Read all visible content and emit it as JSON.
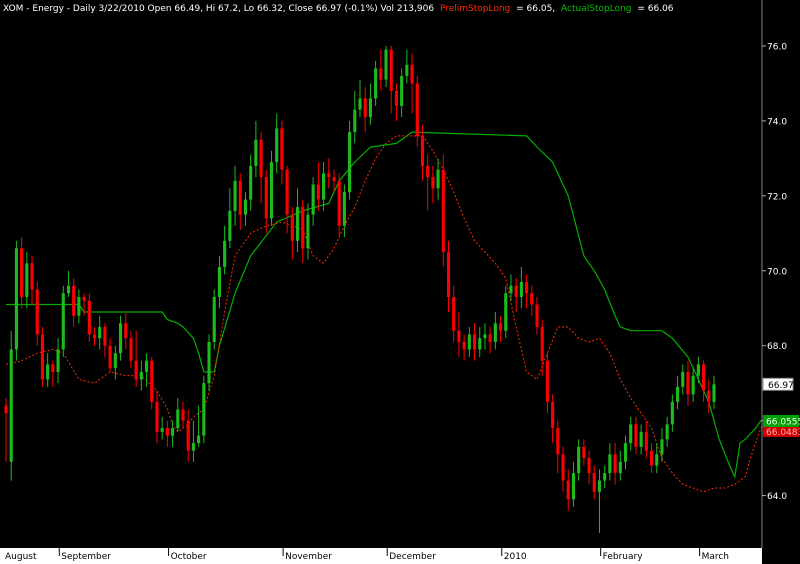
{
  "header": {
    "title": "XOM - Energy - Daily 3/22/2010 Open 66.49, Hi 67.2, Lo 66.32, Close 66.97 (-0.1%) Vol 213,906",
    "prelim_label": "PrelimStopLong",
    "prelim_value": "= 66.05,",
    "actual_label": "ActualStopLong",
    "actual_value": "= 66.06"
  },
  "chart_data": {
    "type": "candlestick",
    "symbol": "XOM",
    "ylim": [
      62.6,
      76.8
    ],
    "y_ticks": [
      "64.0",
      "66.0",
      "68.0",
      "70.0",
      "72.0",
      "74.0",
      "76.0"
    ],
    "x_months": [
      "August",
      "September",
      "October",
      "November",
      "December",
      "2010",
      "February",
      "March"
    ],
    "colors": {
      "up": "#1dbb1d",
      "down": "#ff0000",
      "actual_stop": "#00b000",
      "prelim_stop": "#ff2a00",
      "background": "#000000",
      "axis_bg": "#ffffff"
    },
    "last_close_label": "66.97",
    "actual_stop_label": "66.0555",
    "prelim_stop_label": "66.0483",
    "candles": [
      [
        66.4,
        66.2,
        64.9,
        66.6
      ],
      [
        64.9,
        67.9,
        64.4,
        68.4
      ],
      [
        67.9,
        70.6,
        67.6,
        70.8
      ],
      [
        70.6,
        69.3,
        69.0,
        70.9
      ],
      [
        69.3,
        70.2,
        69.0,
        70.5
      ],
      [
        70.2,
        69.5,
        69.1,
        70.4
      ],
      [
        69.5,
        68.3,
        68.0,
        69.7
      ],
      [
        68.3,
        67.1,
        66.9,
        68.5
      ],
      [
        67.1,
        67.5,
        66.9,
        67.8
      ],
      [
        67.5,
        67.3,
        66.9,
        67.6
      ],
      [
        67.3,
        67.9,
        67.0,
        68.2
      ],
      [
        67.9,
        69.4,
        67.7,
        69.6
      ],
      [
        69.4,
        69.6,
        69.3,
        70.0
      ],
      [
        69.6,
        68.8,
        68.5,
        69.8
      ],
      [
        68.8,
        69.3,
        68.6,
        69.5
      ],
      [
        69.3,
        69.2,
        68.8,
        69.4
      ],
      [
        69.2,
        68.3,
        68.1,
        69.4
      ],
      [
        68.3,
        68.2,
        68.0,
        68.5
      ],
      [
        68.2,
        68.5,
        67.9,
        68.8
      ],
      [
        68.5,
        68.0,
        67.7,
        68.6
      ],
      [
        68.0,
        67.4,
        67.3,
        68.2
      ],
      [
        67.4,
        67.8,
        67.1,
        68.0
      ],
      [
        67.8,
        68.6,
        67.6,
        68.8
      ],
      [
        68.6,
        68.2,
        67.9,
        68.9
      ],
      [
        68.2,
        67.6,
        67.4,
        68.4
      ],
      [
        67.6,
        67.1,
        66.9,
        68.4
      ],
      [
        67.1,
        67.3,
        66.8,
        67.6
      ],
      [
        67.3,
        67.6,
        66.9,
        67.8
      ],
      [
        67.6,
        66.5,
        66.3,
        67.7
      ],
      [
        66.5,
        65.7,
        65.4,
        66.8
      ],
      [
        65.7,
        65.8,
        65.5,
        66.1
      ],
      [
        65.8,
        65.6,
        65.3,
        66.0
      ],
      [
        65.6,
        65.8,
        65.3,
        66.0
      ],
      [
        65.8,
        66.3,
        65.7,
        66.6
      ],
      [
        66.3,
        66.0,
        65.8,
        66.5
      ],
      [
        66.0,
        65.2,
        64.9,
        66.3
      ],
      [
        65.2,
        65.4,
        64.9,
        66.0
      ],
      [
        65.4,
        65.6,
        65.3,
        66.4
      ],
      [
        65.6,
        67.0,
        65.4,
        67.2
      ],
      [
        67.0,
        68.1,
        66.8,
        68.3
      ],
      [
        68.1,
        69.3,
        67.9,
        69.5
      ],
      [
        69.3,
        70.1,
        69.0,
        70.4
      ],
      [
        70.1,
        70.8,
        69.9,
        71.2
      ],
      [
        70.8,
        71.6,
        70.6,
        72.2
      ],
      [
        71.6,
        72.4,
        71.2,
        72.8
      ],
      [
        72.4,
        71.5,
        71.1,
        72.6
      ],
      [
        71.5,
        71.9,
        71.2,
        72.1
      ],
      [
        71.9,
        72.8,
        71.6,
        73.1
      ],
      [
        72.8,
        73.5,
        72.5,
        74.0
      ],
      [
        73.5,
        72.5,
        71.8,
        73.7
      ],
      [
        72.5,
        71.4,
        71.0,
        72.7
      ],
      [
        71.4,
        72.9,
        71.2,
        73.2
      ],
      [
        72.9,
        73.8,
        72.6,
        74.2
      ],
      [
        73.8,
        72.7,
        72.3,
        74.0
      ],
      [
        72.7,
        71.5,
        71.0,
        72.8
      ],
      [
        71.5,
        70.8,
        70.3,
        71.7
      ],
      [
        70.8,
        71.7,
        70.5,
        72.2
      ],
      [
        71.7,
        70.6,
        70.2,
        71.9
      ],
      [
        70.6,
        71.5,
        70.3,
        71.8
      ],
      [
        71.5,
        72.3,
        71.2,
        72.5
      ],
      [
        72.3,
        71.9,
        71.6,
        72.9
      ],
      [
        71.9,
        72.6,
        71.6,
        72.9
      ],
      [
        72.6,
        72.5,
        72.2,
        73.0
      ],
      [
        72.5,
        72.4,
        72.1,
        72.7
      ],
      [
        72.4,
        71.2,
        70.9,
        72.6
      ],
      [
        71.2,
        72.1,
        70.9,
        72.3
      ],
      [
        72.1,
        73.7,
        71.9,
        74.0
      ],
      [
        73.7,
        74.3,
        73.4,
        74.8
      ],
      [
        74.3,
        74.6,
        74.1,
        75.1
      ],
      [
        74.6,
        74.1,
        73.7,
        74.9
      ],
      [
        74.1,
        74.6,
        73.9,
        75.0
      ],
      [
        74.6,
        75.4,
        74.4,
        75.6
      ],
      [
        75.4,
        75.1,
        74.8,
        75.9
      ],
      [
        75.1,
        75.9,
        74.9,
        76.0
      ],
      [
        75.9,
        74.8,
        74.2,
        76.0
      ],
      [
        74.8,
        74.4,
        74.0,
        75.0
      ],
      [
        74.4,
        75.2,
        74.1,
        75.4
      ],
      [
        75.2,
        75.5,
        75.0,
        75.9
      ],
      [
        75.5,
        75.0,
        74.2,
        75.8
      ],
      [
        75.0,
        73.6,
        73.3,
        75.2
      ],
      [
        73.6,
        72.8,
        72.4,
        73.9
      ],
      [
        72.8,
        72.5,
        71.6,
        73.1
      ],
      [
        72.5,
        72.2,
        71.8,
        72.8
      ],
      [
        72.2,
        72.7,
        71.9,
        73.0
      ],
      [
        72.7,
        70.5,
        70.1,
        73.1
      ],
      [
        70.5,
        69.3,
        68.9,
        70.8
      ],
      [
        69.3,
        68.4,
        68.1,
        69.6
      ],
      [
        68.4,
        68.1,
        67.7,
        68.9
      ],
      [
        68.1,
        67.9,
        67.6,
        68.3
      ],
      [
        67.9,
        68.3,
        67.7,
        68.5
      ],
      [
        68.3,
        67.9,
        67.6,
        68.6
      ],
      [
        67.9,
        68.2,
        67.7,
        68.5
      ],
      [
        68.2,
        68.3,
        67.9,
        68.6
      ],
      [
        68.3,
        68.1,
        67.8,
        68.5
      ],
      [
        68.1,
        68.6,
        67.9,
        68.9
      ],
      [
        68.6,
        68.4,
        68.1,
        68.8
      ],
      [
        68.4,
        69.4,
        68.2,
        69.6
      ],
      [
        69.4,
        69.6,
        69.2,
        69.9
      ],
      [
        69.6,
        69.3,
        68.9,
        69.8
      ],
      [
        69.3,
        69.7,
        69.0,
        70.1
      ],
      [
        69.7,
        69.4,
        69.0,
        69.9
      ],
      [
        69.4,
        69.1,
        68.8,
        69.6
      ],
      [
        69.1,
        68.5,
        68.3,
        69.3
      ],
      [
        68.5,
        67.6,
        67.2,
        68.7
      ],
      [
        67.6,
        66.5,
        66.2,
        67.8
      ],
      [
        66.5,
        65.8,
        65.4,
        66.7
      ],
      [
        65.8,
        65.1,
        64.6,
        66.0
      ],
      [
        65.1,
        64.4,
        64.1,
        65.3
      ],
      [
        64.4,
        63.9,
        63.6,
        64.7
      ],
      [
        63.9,
        64.6,
        63.7,
        64.9
      ],
      [
        64.6,
        65.3,
        64.4,
        65.5
      ],
      [
        65.3,
        65.0,
        64.8,
        65.5
      ],
      [
        65.0,
        64.6,
        64.3,
        65.2
      ],
      [
        64.6,
        64.1,
        63.9,
        64.8
      ],
      [
        64.1,
        64.4,
        63.0,
        64.7
      ],
      [
        64.4,
        64.6,
        64.2,
        64.8
      ],
      [
        64.6,
        65.1,
        64.4,
        65.4
      ],
      [
        65.1,
        64.6,
        64.3,
        65.4
      ],
      [
        64.6,
        64.9,
        64.4,
        65.2
      ],
      [
        64.9,
        65.4,
        64.7,
        65.6
      ],
      [
        65.4,
        65.9,
        65.2,
        66.1
      ],
      [
        65.9,
        65.3,
        65.1,
        66.1
      ],
      [
        65.3,
        65.7,
        65.1,
        65.9
      ],
      [
        65.7,
        65.2,
        65.0,
        66.0
      ],
      [
        65.2,
        64.8,
        64.6,
        65.4
      ],
      [
        64.8,
        65.1,
        64.6,
        65.4
      ],
      [
        65.1,
        65.5,
        64.9,
        65.8
      ],
      [
        65.5,
        65.9,
        65.3,
        66.1
      ],
      [
        65.9,
        66.5,
        65.7,
        66.7
      ],
      [
        66.5,
        66.9,
        66.3,
        67.2
      ],
      [
        66.9,
        67.3,
        66.7,
        67.5
      ],
      [
        67.3,
        66.7,
        66.4,
        67.6
      ],
      [
        66.7,
        67.2,
        66.5,
        67.4
      ],
      [
        67.2,
        67.5,
        67.0,
        67.7
      ],
      [
        67.5,
        66.8,
        66.5,
        67.6
      ],
      [
        66.8,
        66.5,
        66.2,
        67.1
      ],
      [
        66.5,
        66.97,
        66.32,
        67.2
      ]
    ],
    "actual_stop": [
      [
        0,
        69.1
      ],
      [
        14,
        69.1
      ],
      [
        15,
        68.9
      ],
      [
        30,
        68.9
      ],
      [
        31,
        68.7
      ],
      [
        33,
        68.6
      ],
      [
        34,
        68.5
      ],
      [
        36,
        68.2
      ],
      [
        37,
        67.8
      ],
      [
        38,
        67.3
      ],
      [
        40,
        67.3
      ],
      [
        41,
        68.0
      ],
      [
        44,
        69.4
      ],
      [
        47,
        70.4
      ],
      [
        52,
        71.3
      ],
      [
        57,
        71.6
      ],
      [
        62,
        71.8
      ],
      [
        64,
        72.4
      ],
      [
        67,
        72.9
      ],
      [
        70,
        73.3
      ],
      [
        75,
        73.4
      ],
      [
        78,
        73.7
      ],
      [
        100,
        73.6
      ],
      [
        102,
        73.3
      ],
      [
        105,
        72.9
      ],
      [
        108,
        72.0
      ],
      [
        111,
        70.4
      ],
      [
        113,
        70.0
      ],
      [
        115,
        69.5
      ],
      [
        117,
        68.8
      ],
      [
        118,
        68.5
      ],
      [
        120,
        68.4
      ],
      [
        126,
        68.4
      ],
      [
        128,
        68.2
      ],
      [
        131,
        67.7
      ],
      [
        133,
        67.1
      ],
      [
        135,
        66.5
      ],
      [
        137,
        65.5
      ],
      [
        139,
        64.8
      ],
      [
        140,
        64.5
      ],
      [
        141,
        65.4
      ],
      [
        142,
        65.5
      ],
      [
        144,
        65.8
      ],
      [
        145,
        66.0
      ],
      [
        146,
        66.0
      ],
      [
        147,
        66.06
      ]
    ],
    "prelim_stop": [
      [
        0,
        67.5
      ],
      [
        3,
        67.6
      ],
      [
        6,
        67.8
      ],
      [
        9,
        67.9
      ],
      [
        11,
        67.8
      ],
      [
        14,
        67.1
      ],
      [
        17,
        67.0
      ],
      [
        20,
        67.3
      ],
      [
        23,
        67.2
      ],
      [
        26,
        67.2
      ],
      [
        29,
        66.8
      ],
      [
        31,
        66.3
      ],
      [
        32,
        65.9
      ],
      [
        33,
        65.7
      ],
      [
        35,
        65.9
      ],
      [
        36,
        66.1
      ],
      [
        38,
        66.3
      ],
      [
        40,
        67.2
      ],
      [
        42,
        68.9
      ],
      [
        44,
        70.4
      ],
      [
        47,
        71.0
      ],
      [
        50,
        71.2
      ],
      [
        53,
        71.3
      ],
      [
        55,
        71.2
      ],
      [
        57,
        71.1
      ],
      [
        59,
        70.4
      ],
      [
        61,
        70.2
      ],
      [
        63,
        70.6
      ],
      [
        65,
        71.2
      ],
      [
        67,
        71.7
      ],
      [
        69,
        72.4
      ],
      [
        71,
        73.0
      ],
      [
        73,
        73.4
      ],
      [
        75,
        73.6
      ],
      [
        77,
        73.6
      ],
      [
        80,
        73.6
      ],
      [
        82,
        73.2
      ],
      [
        84,
        72.7
      ],
      [
        86,
        72.1
      ],
      [
        88,
        71.4
      ],
      [
        90,
        70.8
      ],
      [
        92,
        70.5
      ],
      [
        94,
        70.2
      ],
      [
        96,
        69.8
      ],
      [
        98,
        68.5
      ],
      [
        100,
        67.3
      ],
      [
        102,
        67.1
      ],
      [
        104,
        67.8
      ],
      [
        106,
        68.5
      ],
      [
        108,
        68.5
      ],
      [
        110,
        68.2
      ],
      [
        112,
        68.1
      ],
      [
        114,
        68.2
      ],
      [
        116,
        67.8
      ],
      [
        118,
        67.1
      ],
      [
        120,
        66.6
      ],
      [
        122,
        66.2
      ],
      [
        124,
        65.8
      ],
      [
        126,
        65.0
      ],
      [
        128,
        64.6
      ],
      [
        130,
        64.3
      ],
      [
        132,
        64.2
      ],
      [
        134,
        64.1
      ],
      [
        136,
        64.2
      ],
      [
        138,
        64.2
      ],
      [
        140,
        64.3
      ],
      [
        142,
        64.5
      ],
      [
        143,
        65.0
      ],
      [
        144,
        65.4
      ],
      [
        145,
        65.8
      ],
      [
        146,
        66.0
      ],
      [
        147,
        66.05
      ]
    ]
  }
}
